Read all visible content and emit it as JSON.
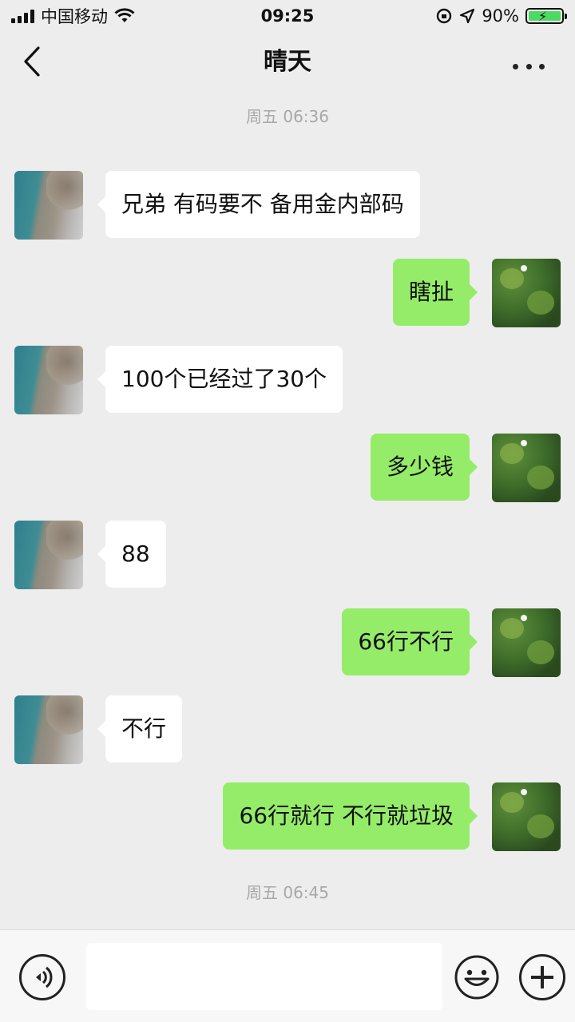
{
  "status_bar": {
    "carrier": "中国移动",
    "time": "09:25",
    "battery": "90%"
  },
  "nav": {
    "title": "晴天"
  },
  "timestamps": [
    "周五 06:36",
    "周五 06:45"
  ],
  "messages": [
    {
      "side": "left",
      "text": "兄弟 有码要不 备用金内部码"
    },
    {
      "side": "right",
      "text": "瞎扯"
    },
    {
      "side": "left",
      "text": "100个已经过了30个"
    },
    {
      "side": "right",
      "text": "多少钱"
    },
    {
      "side": "left",
      "text": "88"
    },
    {
      "side": "right",
      "text": "66行不行"
    },
    {
      "side": "left",
      "text": "不行"
    },
    {
      "side": "right",
      "text": "66行就行 不行就垃圾"
    }
  ],
  "input": {
    "value": ""
  },
  "icons": {
    "back": "chevron-left-icon",
    "more": "more-dots-icon",
    "voice": "voice-icon",
    "emoji": "emoji-icon",
    "plus": "plus-icon"
  },
  "colors": {
    "background": "#ededed",
    "sent_bubble": "#95ec69",
    "received_bubble": "#ffffff"
  }
}
